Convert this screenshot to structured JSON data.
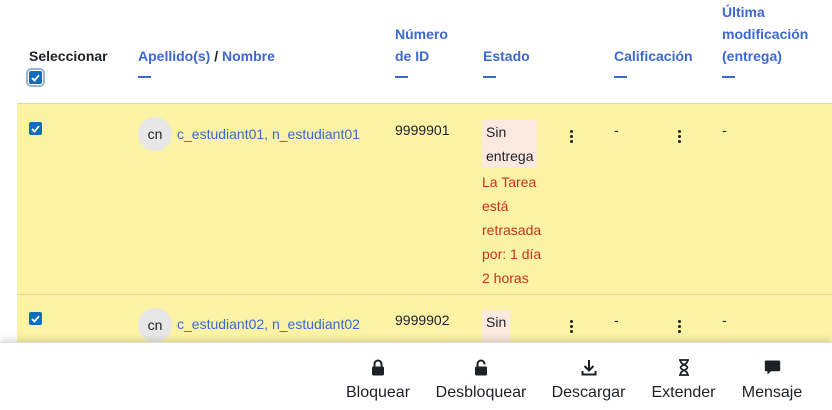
{
  "header": {
    "select_label": "Seleccionar",
    "lastname_label": "Apellido(s)",
    "separator": "/",
    "firstname_label": "Nombre",
    "idnumber_line1": "Número",
    "idnumber_line2": "de ID",
    "status_label": "Estado",
    "grade_label": "Calificación",
    "modified_line1": "Última",
    "modified_line2": "modificación",
    "modified_line3": "(entrega)"
  },
  "rows": [
    {
      "initials": "cn",
      "fullname": "c_estudiant01, n_estudiant01",
      "idnumber": "9999901",
      "status_line1": "Sin",
      "status_line2": "entrega",
      "late_lines": [
        "La Tarea",
        "está",
        "retrasada",
        "por: 1 día",
        "2 horas"
      ],
      "grade": "-",
      "modified": "-",
      "selected": true
    },
    {
      "initials": "cn",
      "fullname": "c_estudiant02, n_estudiant02",
      "idnumber": "9999902",
      "status_line1": "Sin",
      "grade": "-",
      "modified": "-",
      "selected": true
    }
  ],
  "toolbar": {
    "lock": {
      "label": "Bloquear",
      "icon": "lock-icon"
    },
    "unlock": {
      "label": "Desbloquear",
      "icon": "unlock-icon"
    },
    "download": {
      "label": "Descargar",
      "icon": "download-icon"
    },
    "extend": {
      "label": "Extender",
      "icon": "hourglass-icon"
    },
    "message": {
      "label": "Mensaje",
      "icon": "message-icon"
    }
  },
  "colors": {
    "link": "#3b68d1",
    "row_highlight": "#fbf2a6",
    "status_badge": "#fbe8de",
    "late_text": "#ca3120",
    "checkbox": "#0f6cbf"
  }
}
